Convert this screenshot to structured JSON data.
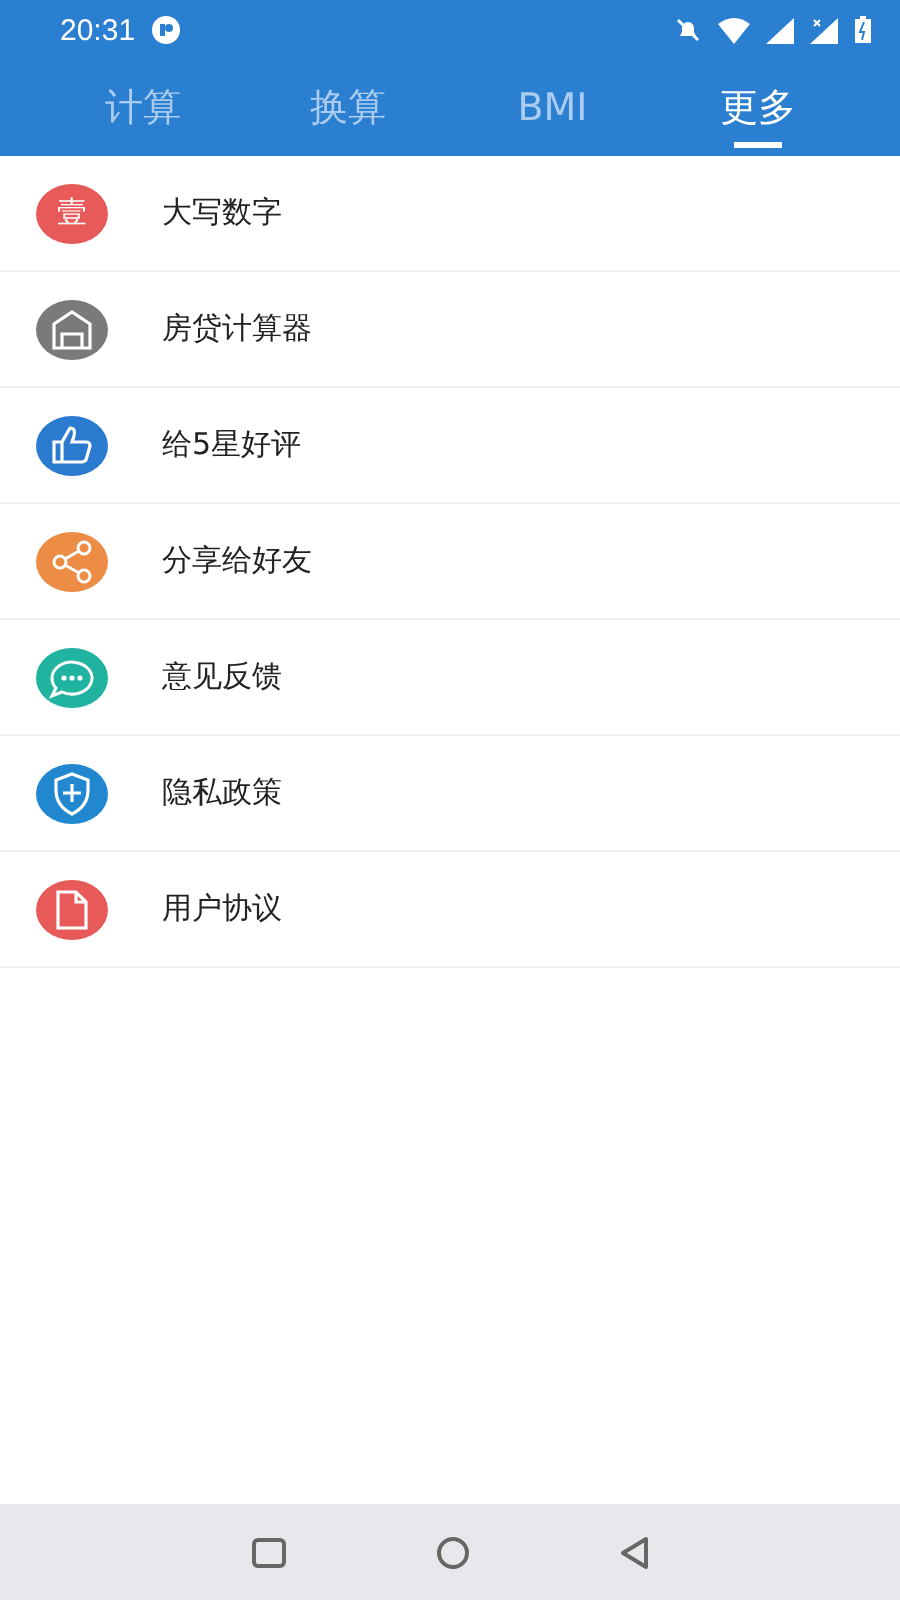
{
  "status_bar": {
    "time": "20:31"
  },
  "tabs": [
    {
      "label": "计算",
      "selected": false
    },
    {
      "label": "换算",
      "selected": false
    },
    {
      "label": "BMI",
      "selected": false
    },
    {
      "label": "更多",
      "selected": true
    }
  ],
  "items": [
    {
      "kind": "glyph",
      "glyph": "壹",
      "color": "#e85a5a",
      "label": "大写数字"
    },
    {
      "kind": "house",
      "color": "#7a7a7a",
      "label": "房贷计算器"
    },
    {
      "kind": "thumb",
      "color": "#2a7bd0",
      "label": "给5星好评"
    },
    {
      "kind": "share",
      "color": "#ec8c45",
      "label": "分享给好友"
    },
    {
      "kind": "chat",
      "color": "#1fb3a0",
      "label": "意见反馈"
    },
    {
      "kind": "shield",
      "color": "#2188d0",
      "label": "隐私政策"
    },
    {
      "kind": "document",
      "color": "#e85a5a",
      "label": "用户协议"
    }
  ]
}
